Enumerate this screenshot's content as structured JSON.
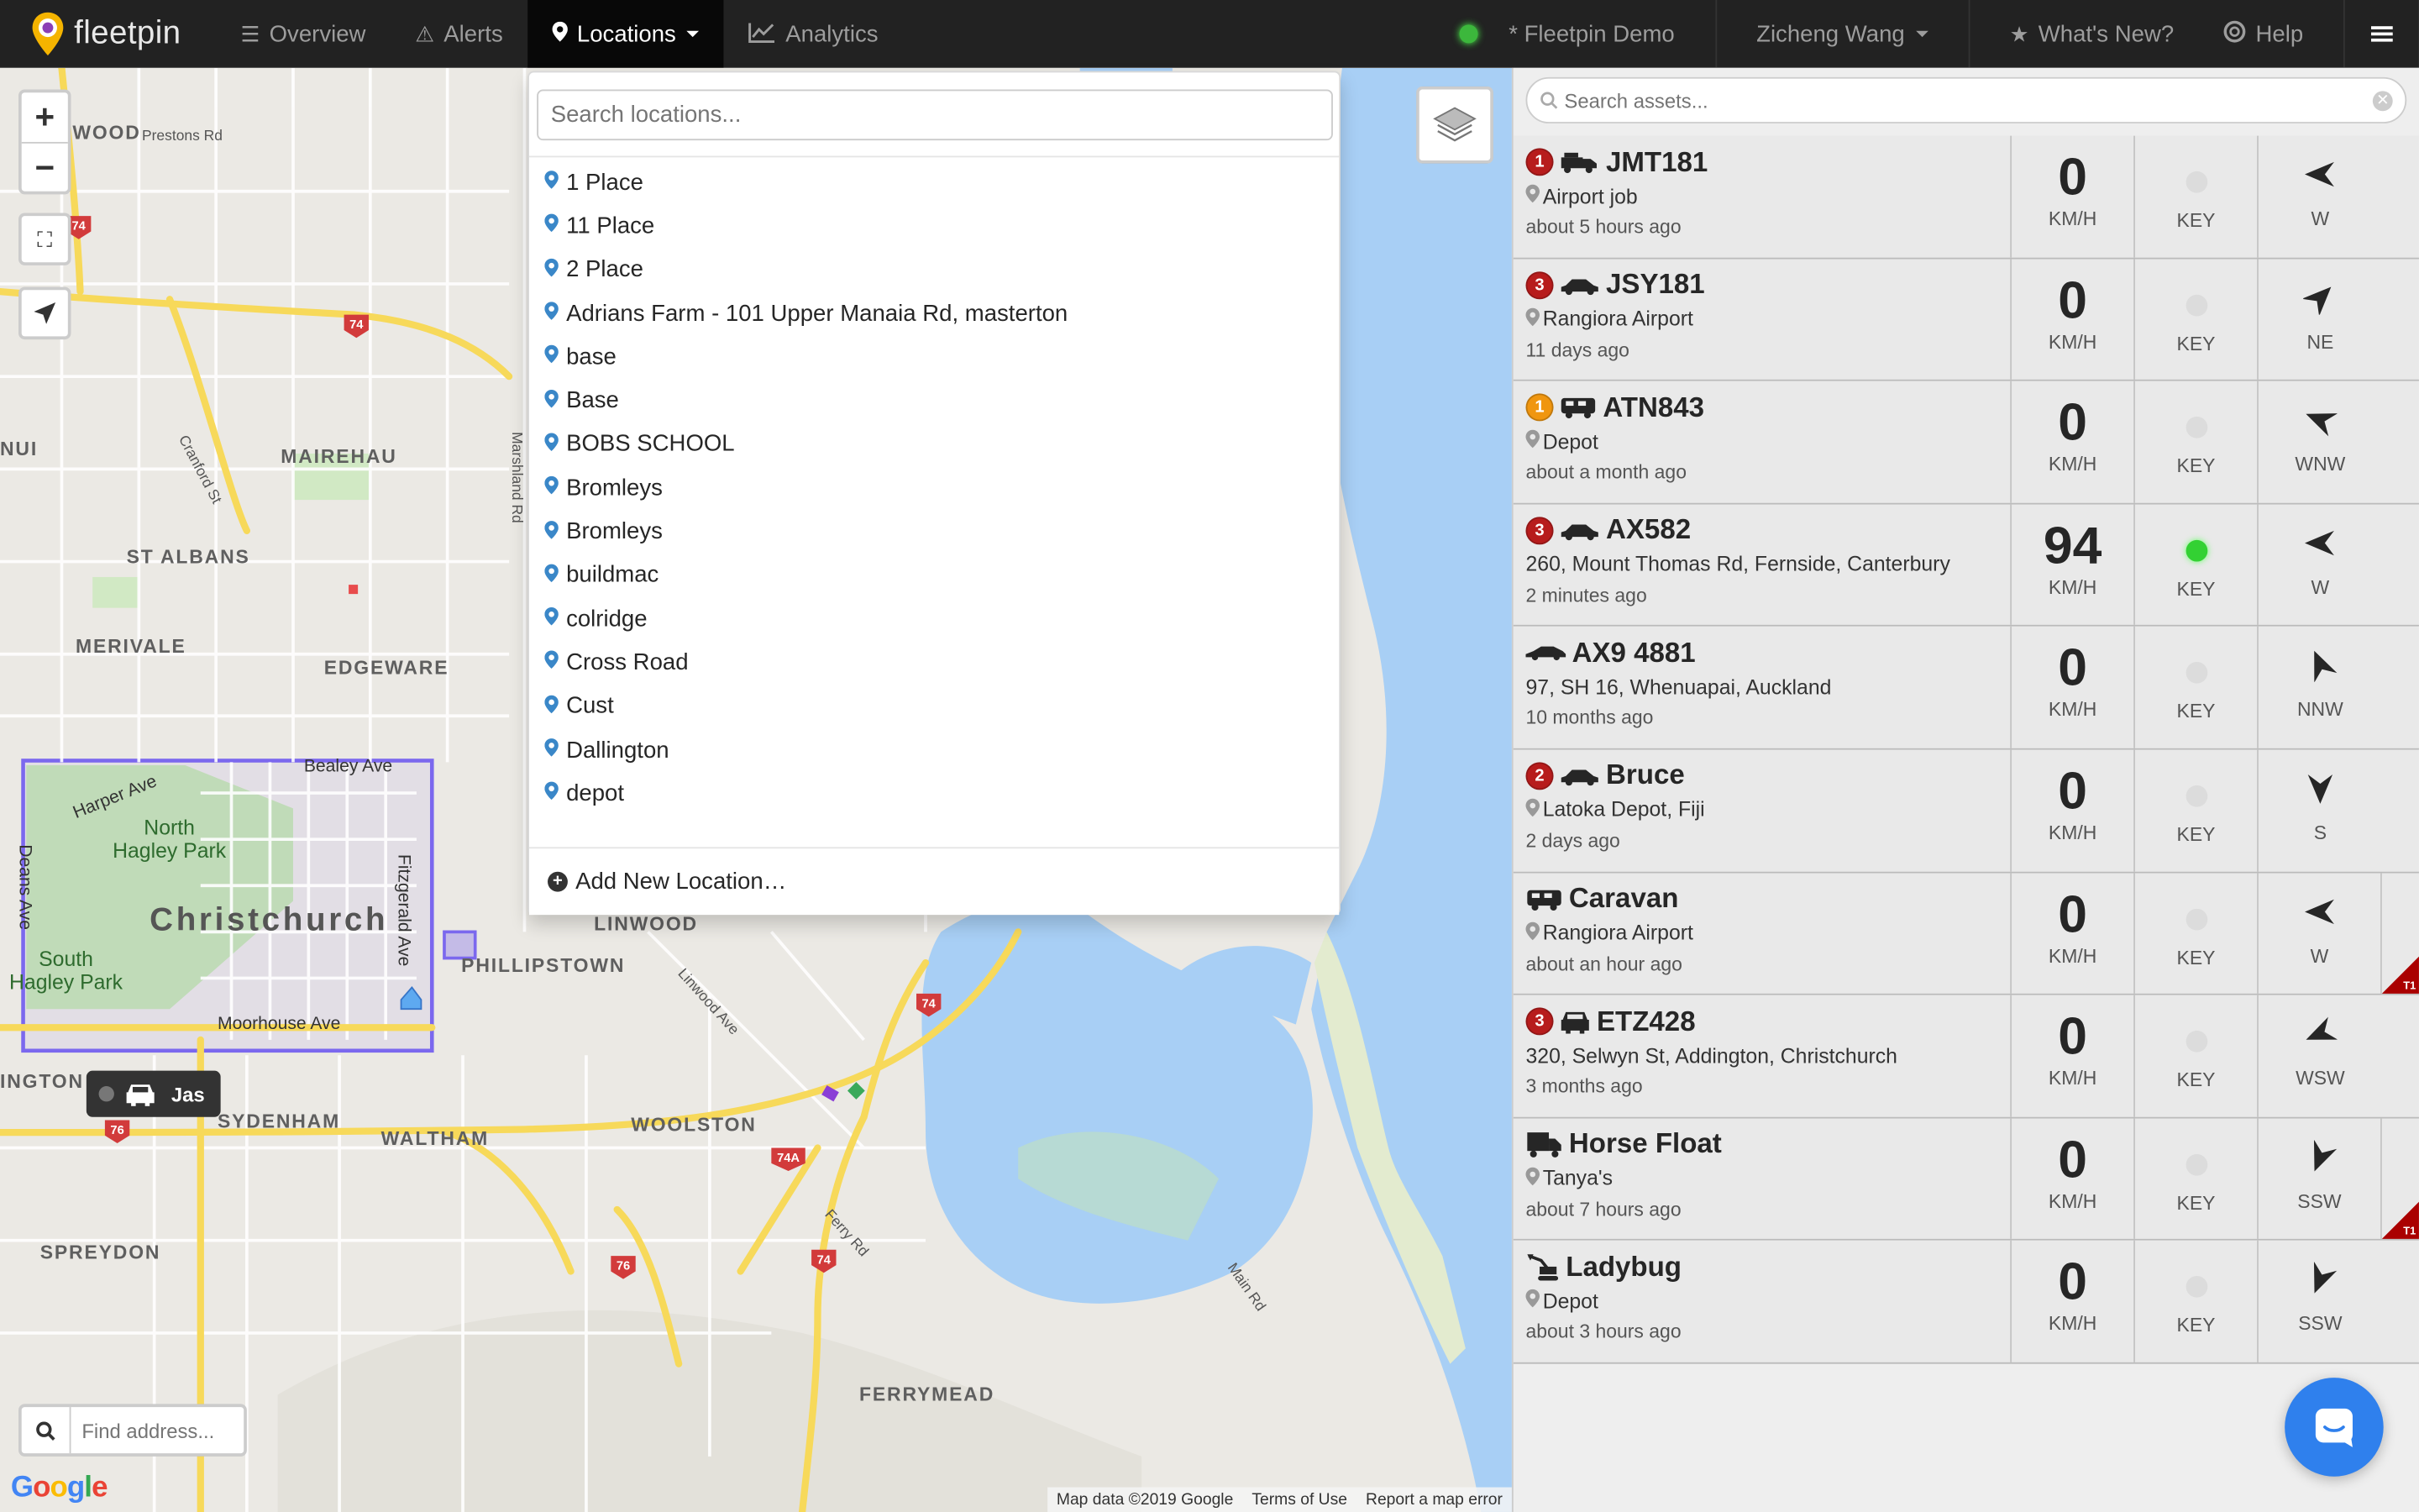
{
  "brand": {
    "name": "fleetpin"
  },
  "nav": {
    "overview": "Overview",
    "alerts": "Alerts",
    "locations": "Locations",
    "analytics": "Analytics",
    "account": "* Fleetpin Demo",
    "user": "Zicheng Wang",
    "whats_new": "What's New?",
    "help": "Help"
  },
  "locations_menu": {
    "search_placeholder": "Search locations...",
    "items": [
      "1 Place",
      "11 Place",
      "2 Place",
      "Adrians Farm - 101 Upper Manaia Rd, masterton",
      "base",
      "Base",
      "BOBS SCHOOL",
      "Bromleys",
      "Bromleys",
      "buildmac",
      "colridge",
      "Cross Road",
      "Cust",
      "Dallington",
      "depot"
    ],
    "add_new": "Add New Location…"
  },
  "map": {
    "find_address_placeholder": "Find address...",
    "google": "Google",
    "footer": {
      "data": "Map data ©2019 Google",
      "terms": "Terms of Use",
      "report": "Report a map error"
    },
    "marker_label": "Jas",
    "labels": {
      "city": "Christchurch",
      "mairehau": "MAIREHAU",
      "st_albans": "ST ALBANS",
      "merivale": "MERIVALE",
      "edgeware": "EDGEWARE",
      "linwood": "LINWOOD",
      "phillipstown": "PHILLIPSTOWN",
      "woolston": "WOOLSTON",
      "sydenham": "SYDENHAM",
      "waltham": "WALTHAM",
      "spreydon": "SPREYDON",
      "ferrymead": "FERRYMEAD",
      "north_hagley_park": "North\nHagley Park",
      "south_hagley_park": "South\nHagley Park",
      "bealey_ave": "Bealey Ave",
      "moorhouse_ave": "Moorhouse Ave",
      "harper_ave": "Harper Ave",
      "fitzgerald_ave": "Fitzgerald Ave",
      "deans_ave": "Deans Ave",
      "wood": "WOOD",
      "nui": "NUI",
      "ington": "INGTON",
      "preston_rd": "Prestons Rd",
      "cranford_st": "Cranford St",
      "marshland_rd": "Marshland Rd",
      "linwood_ave": "Linwood Ave",
      "ferry_rd": "Ferry Rd",
      "main_rd": "Main Rd"
    }
  },
  "asset_search_placeholder": "Search assets...",
  "assets": [
    {
      "badge": "1",
      "badge_color": "#b71c1c",
      "vehicle": "truck",
      "name": "JMT181",
      "location": "Airport job",
      "pin": true,
      "time": "about 5 hours ago",
      "speed": "0",
      "key_on": false,
      "direction": "W",
      "dir_deg": 270,
      "t1": false
    },
    {
      "badge": "3",
      "badge_color": "#b71c1c",
      "vehicle": "car",
      "name": "JSY181",
      "location": "Rangiora Airport",
      "pin": true,
      "time": "11 days ago",
      "speed": "0",
      "key_on": false,
      "direction": "NE",
      "dir_deg": 45,
      "t1": false
    },
    {
      "badge": "1",
      "badge_color": "#f0960f",
      "vehicle": "rv",
      "name": "ATN843",
      "location": "Depot",
      "pin": true,
      "time": "about a month ago",
      "speed": "0",
      "key_on": false,
      "direction": "WNW",
      "dir_deg": 292,
      "t1": false
    },
    {
      "badge": "3",
      "badge_color": "#b71c1c",
      "vehicle": "car",
      "name": "AX582",
      "location": "260, Mount Thomas Rd, Fernside, Canterbury",
      "pin": false,
      "time": "2 minutes ago",
      "speed": "94",
      "key_on": true,
      "direction": "W",
      "dir_deg": 270,
      "t1": false
    },
    {
      "badge": "",
      "badge_color": "",
      "vehicle": "sportscar",
      "name": "AX9 4881",
      "location": "97, SH 16, Whenuapai, Auckland",
      "pin": false,
      "time": "10 months ago",
      "speed": "0",
      "key_on": false,
      "direction": "NNW",
      "dir_deg": 337,
      "t1": false
    },
    {
      "badge": "2",
      "badge_color": "#b71c1c",
      "vehicle": "car",
      "name": "Bruce",
      "location": "Latoka Depot, Fiji",
      "pin": true,
      "time": "2 days ago",
      "speed": "0",
      "key_on": false,
      "direction": "S",
      "dir_deg": 180,
      "t1": false
    },
    {
      "badge": "",
      "badge_color": "",
      "vehicle": "rv",
      "name": "Caravan",
      "location": "Rangiora Airport",
      "pin": true,
      "time": "about an hour ago",
      "speed": "0",
      "key_on": false,
      "direction": "W",
      "dir_deg": 270,
      "t1": true
    },
    {
      "badge": "3",
      "badge_color": "#b71c1c",
      "vehicle": "carfront",
      "name": "ETZ428",
      "location": "320, Selwyn St, Addington, Christchurch",
      "pin": false,
      "time": "3 months ago",
      "speed": "0",
      "key_on": false,
      "direction": "WSW",
      "dir_deg": 247,
      "t1": false
    },
    {
      "badge": "",
      "badge_color": "",
      "vehicle": "lorry",
      "name": "Horse Float",
      "location": "Tanya's",
      "pin": true,
      "time": "about 7 hours ago",
      "speed": "0",
      "key_on": false,
      "direction": "SSW",
      "dir_deg": 202,
      "t1": true
    },
    {
      "badge": "",
      "badge_color": "",
      "vehicle": "excavator",
      "name": "Ladybug",
      "location": "Depot",
      "pin": true,
      "time": "about 3 hours ago",
      "speed": "0",
      "key_on": false,
      "direction": "SSW",
      "dir_deg": 202,
      "t1": false
    }
  ],
  "stat_labels": {
    "speed_unit": "KM/H",
    "key": "KEY"
  },
  "t1_label": "T1",
  "colors": {
    "topbar": "#222222",
    "accent_blue": "#2f80ed",
    "key_on": "#33d133",
    "badge_red": "#b71c1c",
    "badge_orange": "#f0960f",
    "geofence": "#7b68ee"
  }
}
